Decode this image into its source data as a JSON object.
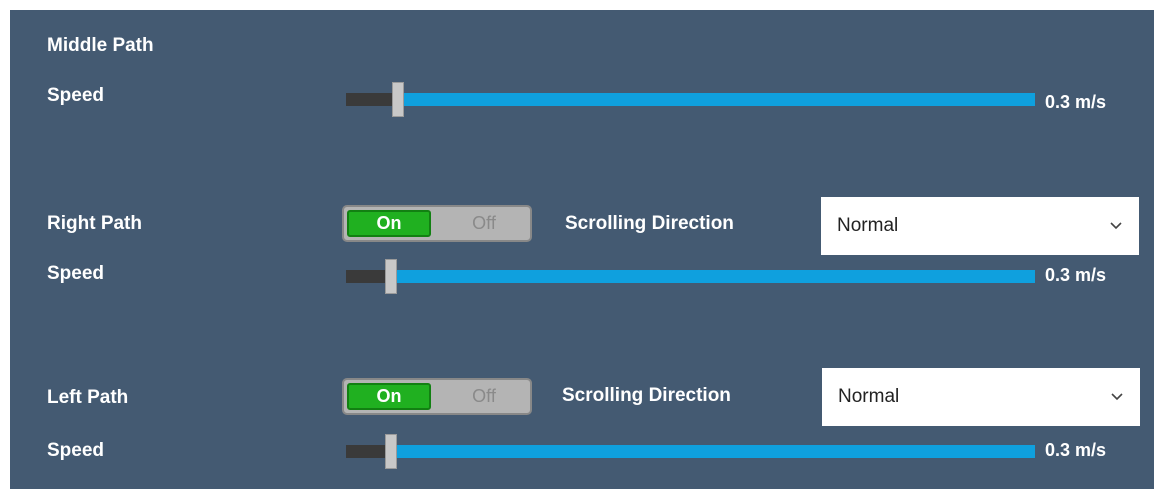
{
  "middle_path": {
    "title": "Middle Path",
    "speed_label": "Speed",
    "speed_value": "0.3 m/s",
    "speed_fraction": 0.07
  },
  "right_path": {
    "title": "Right Path",
    "toggle": {
      "on_label": "On",
      "off_label": "Off",
      "state": "on"
    },
    "scrolling_label": "Scrolling Direction",
    "scrolling_value": "Normal",
    "speed_label": "Speed",
    "speed_value": "0.3 m/s",
    "speed_fraction": 0.06
  },
  "left_path": {
    "title": "Left Path",
    "toggle": {
      "on_label": "On",
      "off_label": "Off",
      "state": "on"
    },
    "scrolling_label": "Scrolling Direction",
    "scrolling_value": "Normal",
    "speed_label": "Speed",
    "speed_value": "0.3 m/s",
    "speed_fraction": 0.06
  },
  "colors": {
    "panel_bg": "#445a72",
    "slider_fill": "#0fa0de",
    "toggle_on": "#20b020"
  },
  "icons": {
    "dropdown": "chevron-down-icon"
  }
}
